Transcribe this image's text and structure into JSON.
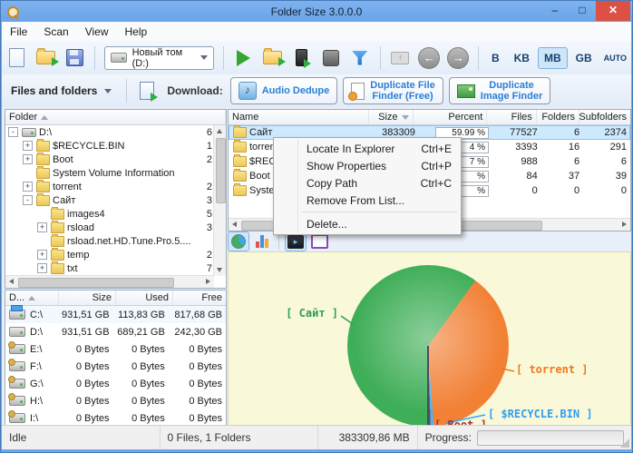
{
  "window": {
    "title": "Folder Size 3.0.0.0",
    "controls": {
      "minimize": "–",
      "maximize": "□",
      "close": "✕"
    }
  },
  "menu_bar": {
    "items": [
      "File",
      "Scan",
      "View",
      "Help"
    ]
  },
  "toolbar": {
    "drive_combo": {
      "value": "Новый том (D:)"
    },
    "units": {
      "options": [
        "B",
        "KB",
        "MB",
        "GB",
        "AUTO"
      ],
      "selected": "MB"
    }
  },
  "actions_bar": {
    "scope_dropdown": "Files and folders",
    "download_label": "Download:",
    "promos": [
      {
        "lines": [
          "Audio Dedupe"
        ]
      },
      {
        "lines": [
          "Duplicate File",
          "Finder (Free)"
        ]
      },
      {
        "lines": [
          "Duplicate",
          "Image Finder"
        ]
      }
    ]
  },
  "folder_tree": {
    "header": "Folder",
    "items": [
      {
        "indent": 0,
        "expander": "-",
        "icon": "drive",
        "label": "D:\\",
        "value": "6"
      },
      {
        "indent": 1,
        "expander": "+",
        "icon": "folder",
        "label": "$RECYCLE.BIN",
        "value": "1"
      },
      {
        "indent": 1,
        "expander": "+",
        "icon": "folder",
        "label": "Boot",
        "value": "2"
      },
      {
        "indent": 1,
        "expander": "",
        "icon": "folder",
        "label": "System Volume Information",
        "value": ""
      },
      {
        "indent": 1,
        "expander": "+",
        "icon": "folder",
        "label": "torrent",
        "value": "2"
      },
      {
        "indent": 1,
        "expander": "-",
        "icon": "folder",
        "label": "Сайт",
        "value": "3"
      },
      {
        "indent": 2,
        "expander": "",
        "icon": "folder",
        "label": "images4",
        "value": "5"
      },
      {
        "indent": 2,
        "expander": "+",
        "icon": "folder",
        "label": "rsload",
        "value": "3"
      },
      {
        "indent": 2,
        "expander": "",
        "icon": "folder",
        "label": "rsload.net.HD.Tune.Pro.5....",
        "value": ""
      },
      {
        "indent": 2,
        "expander": "+",
        "icon": "folder",
        "label": "temp",
        "value": "2"
      },
      {
        "indent": 2,
        "expander": "+",
        "icon": "folder",
        "label": "txt",
        "value": "7"
      }
    ]
  },
  "file_table": {
    "columns": [
      "Name",
      "Size",
      "Percent",
      "Files",
      "Folders",
      "Subfolders"
    ],
    "sort_column": "Size",
    "rows": [
      {
        "name": "Сайт",
        "size": "383309",
        "percent": "59.99 %",
        "files": "77527",
        "folders": "6",
        "subfolders": "2374",
        "selected": true
      },
      {
        "name": "torrent",
        "size": "",
        "percent": "4 %",
        "files": "3393",
        "folders": "16",
        "subfolders": "291",
        "selected": false
      },
      {
        "name": "$RECYCLE.BIN",
        "size": "",
        "percent": "7 %",
        "files": "988",
        "folders": "6",
        "subfolders": "6",
        "selected": false
      },
      {
        "name": "Boot",
        "size": "",
        "percent": "%",
        "files": "84",
        "folders": "37",
        "subfolders": "39",
        "selected": false
      },
      {
        "name": "System Volume Information",
        "size": "",
        "percent": "%",
        "files": "0",
        "folders": "0",
        "subfolders": "0",
        "selected": false
      }
    ]
  },
  "context_menu": {
    "items": [
      {
        "label": "Locate In Explorer",
        "shortcut": "Ctrl+E"
      },
      {
        "label": "Show Properties",
        "shortcut": "Ctrl+P"
      },
      {
        "label": "Copy Path",
        "shortcut": "Ctrl+C"
      },
      {
        "label": "Remove From List...",
        "shortcut": ""
      },
      {
        "separator": true
      },
      {
        "label": "Delete...",
        "shortcut": ""
      }
    ]
  },
  "drive_table": {
    "columns": [
      "D...",
      "Size",
      "Used",
      "Free"
    ],
    "rows": [
      {
        "drive": "C:\\",
        "size": "931,51 GB",
        "used": "113,83 GB",
        "free": "817,68 GB",
        "icon": "system-drive",
        "highlight": true
      },
      {
        "drive": "D:\\",
        "size": "931,51 GB",
        "used": "689,21 GB",
        "free": "242,30 GB",
        "icon": "drive",
        "highlight": false
      },
      {
        "drive": "E:\\",
        "size": "0 Bytes",
        "used": "0 Bytes",
        "free": "0 Bytes",
        "icon": "drive-badge",
        "highlight": false
      },
      {
        "drive": "F:\\",
        "size": "0 Bytes",
        "used": "0 Bytes",
        "free": "0 Bytes",
        "icon": "drive-badge",
        "highlight": false
      },
      {
        "drive": "G:\\",
        "size": "0 Bytes",
        "used": "0 Bytes",
        "free": "0 Bytes",
        "icon": "drive-badge",
        "highlight": false
      },
      {
        "drive": "H:\\",
        "size": "0 Bytes",
        "used": "0 Bytes",
        "free": "0 Bytes",
        "icon": "drive-badge",
        "highlight": false
      },
      {
        "drive": "I:\\",
        "size": "0 Bytes",
        "used": "0 Bytes",
        "free": "0 Bytes",
        "icon": "drive-badge",
        "highlight": false
      }
    ]
  },
  "status_bar": {
    "state": "Idle",
    "counts": "0 Files, 1 Folders",
    "total_size": "383309,86 MB",
    "progress_label": "Progress:"
  },
  "colors": {
    "accent": "#2a7fd4",
    "selection": "#cde9fd",
    "titlebar": "#74abec",
    "close_button": "#dd5044",
    "chart_bg": "#f9f9da"
  },
  "chart_data": {
    "type": "pie",
    "title": "",
    "legend_position": "callout",
    "slices": [
      {
        "name": "Сайт",
        "percent": 59.99,
        "color": "#3fae58"
      },
      {
        "name": "torrent",
        "percent": 38.9,
        "color": "#f28136"
      },
      {
        "name": "$RECYCLE.BIN",
        "percent": 0.6,
        "color": "#55b0ee"
      },
      {
        "name": "Boot",
        "percent": 0.51,
        "color": "#5a5564"
      }
    ],
    "callouts": [
      {
        "text": "[ Сайт ]",
        "color": "#2e9e4f"
      },
      {
        "text": "[ torrent ]",
        "color": "#f07820"
      },
      {
        "text": "[ $RECYCLE.BIN ]",
        "color": "#2e9df2"
      },
      {
        "text": "[ Boot ]",
        "color": "#a03636"
      }
    ]
  }
}
